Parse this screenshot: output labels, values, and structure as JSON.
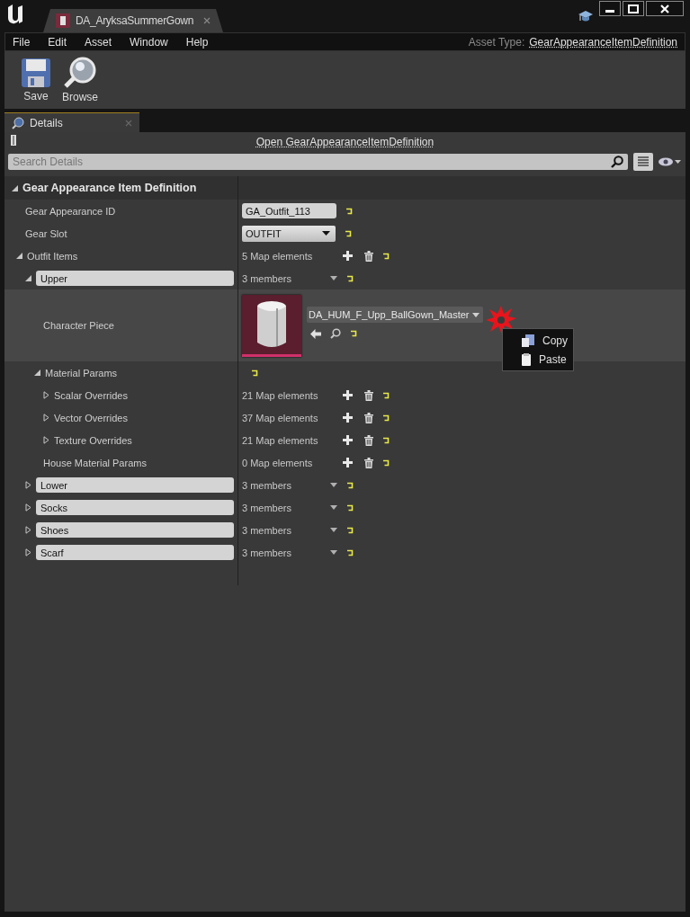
{
  "window": {
    "tab_title": "DA_AryksaSummerGown"
  },
  "menu": [
    "File",
    "Edit",
    "Asset",
    "Window",
    "Help"
  ],
  "asset_type": {
    "label": "Asset Type:",
    "value": "GearAppearanceItemDefinition"
  },
  "toolbar": [
    {
      "label": "Save",
      "kind": "save"
    },
    {
      "label": "Browse",
      "kind": "browse"
    }
  ],
  "panel_tab": {
    "label": "Details"
  },
  "open_link": "Open GearAppearanceItemDefinition",
  "search": {
    "placeholder": "Search Details"
  },
  "tree": [
    {
      "kind": "category",
      "label": "Gear Appearance Item Definition",
      "expanded": true,
      "children": [
        {
          "kind": "text",
          "label": "Gear Appearance ID",
          "value": "GA_Outfit_113"
        },
        {
          "kind": "combo",
          "label": "Gear Slot",
          "value": "OUTFIT"
        },
        {
          "kind": "map",
          "label": "Outfit Items",
          "value": "5 Map elements",
          "expanded": true,
          "children": [
            {
              "kind": "struct",
              "label": "Upper",
              "value": "3 members",
              "expanded": true,
              "children": [
                {
                  "kind": "asset",
                  "label": "Character Piece",
                  "value": "DA_HUM_F_Upp_BallGown_Master"
                },
                {
                  "kind": "group",
                  "label": "Material Params",
                  "expanded": true,
                  "children": [
                    {
                      "kind": "map",
                      "label": "Scalar Overrides",
                      "value": "21 Map elements",
                      "expanded": false
                    },
                    {
                      "kind": "map",
                      "label": "Vector Overrides",
                      "value": "37 Map elements",
                      "expanded": false
                    },
                    {
                      "kind": "map",
                      "label": "Texture Overrides",
                      "value": "21 Map elements",
                      "expanded": false
                    }
                  ]
                },
                {
                  "kind": "map",
                  "label": "House Material Params",
                  "value": "0 Map elements"
                }
              ]
            },
            {
              "kind": "struct",
              "label": "Lower",
              "value": "3 members",
              "expanded": false
            },
            {
              "kind": "struct",
              "label": "Socks",
              "value": "3 members",
              "expanded": false
            },
            {
              "kind": "struct",
              "label": "Shoes",
              "value": "3 members",
              "expanded": false
            },
            {
              "kind": "struct",
              "label": "Scarf",
              "value": "3 members",
              "expanded": false
            }
          ]
        }
      ]
    }
  ],
  "context_menu": [
    {
      "label": "Copy",
      "kind": "copy"
    },
    {
      "label": "Paste",
      "kind": "paste"
    }
  ]
}
